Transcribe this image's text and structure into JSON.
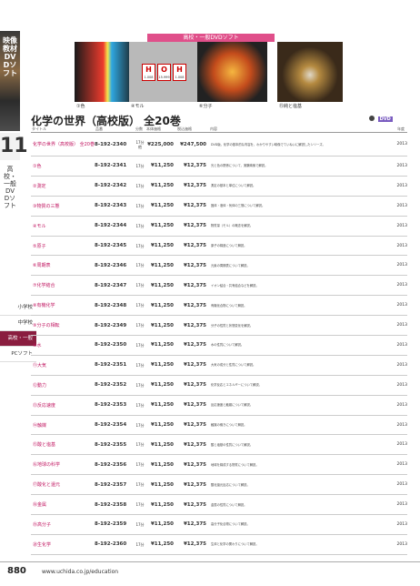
{
  "side": {
    "vertical_title": "映像教材 DVDソフト",
    "number": "11",
    "category": "高校・一般DVDソフト",
    "tabs": [
      "小学校",
      "中学校",
      "高校・一般",
      "PCソフト"
    ],
    "active_tab": 2
  },
  "header_bar": "高校・一般DVDソフト",
  "captions": [
    "①色",
    "④モル",
    "⑥分子",
    "⑮純と塩基"
  ],
  "elements": [
    {
      "symbol": "H",
      "number": "1",
      "mass": "1.008"
    },
    {
      "symbol": "O",
      "number": "8",
      "mass": "15.999"
    },
    {
      "symbol": "H",
      "number": "1",
      "mass": "1.008"
    }
  ],
  "series_title": "化学の世界（高校版） 全20巻",
  "dvd_label": "DVD",
  "columns": [
    "タイトル",
    "品番",
    "分数",
    "本体価格",
    "税込価格",
    "内容",
    "年度"
  ],
  "rows": [
    {
      "title": "化学の世界（高校版） 全20巻",
      "code": "8-192-2340",
      "min": "17分 他",
      "price": "¥225,000",
      "tax": "¥247,500",
      "desc": "DVD版。化学の基本的な内容を、わかりやすい映像でていねいに解説したシリーズ。",
      "year": "2013"
    },
    {
      "title": "①色",
      "code": "8-192-2341",
      "min": "17分",
      "price": "¥11,250",
      "tax": "¥12,375",
      "desc": "光と色の関係について、実験映像で解説。",
      "year": "2013"
    },
    {
      "title": "②測定",
      "code": "8-192-2342",
      "min": "17分",
      "price": "¥11,250",
      "tax": "¥12,375",
      "desc": "測定の基本と単位について解説。",
      "year": "2013"
    },
    {
      "title": "③物質の三態",
      "code": "8-192-2343",
      "min": "17分",
      "price": "¥11,250",
      "tax": "¥12,375",
      "desc": "固体・液体・気体の三態について解説。",
      "year": "2013"
    },
    {
      "title": "④モル",
      "code": "8-192-2344",
      "min": "17分",
      "price": "¥11,250",
      "tax": "¥12,375",
      "desc": "物質量（モル）の概念を解説。",
      "year": "2013"
    },
    {
      "title": "⑤原子",
      "code": "8-192-2345",
      "min": "17分",
      "price": "¥11,250",
      "tax": "¥12,375",
      "desc": "原子の構造について解説。",
      "year": "2013"
    },
    {
      "title": "⑥周期表",
      "code": "8-192-2346",
      "min": "17分",
      "price": "¥11,250",
      "tax": "¥12,375",
      "desc": "元素の周期表について解説。",
      "year": "2013"
    },
    {
      "title": "⑦化学結合",
      "code": "8-192-2347",
      "min": "17分",
      "price": "¥11,250",
      "tax": "¥12,375",
      "desc": "イオン結合・共有結合などを解説。",
      "year": "2013"
    },
    {
      "title": "⑧有機化学",
      "code": "8-192-2348",
      "min": "17分",
      "price": "¥11,250",
      "tax": "¥12,375",
      "desc": "有機化合物について解説。",
      "year": "2013"
    },
    {
      "title": "⑨分子の相転",
      "code": "8-192-2349",
      "min": "17分",
      "price": "¥11,250",
      "tax": "¥12,375",
      "desc": "分子の性質と状態変化を解説。",
      "year": "2013"
    },
    {
      "title": "⑩水",
      "code": "8-192-2350",
      "min": "17分",
      "price": "¥11,250",
      "tax": "¥12,375",
      "desc": "水の性質について解説。",
      "year": "2013"
    },
    {
      "title": "⑪大気",
      "code": "8-192-2351",
      "min": "17分",
      "price": "¥11,250",
      "tax": "¥12,375",
      "desc": "大気の成分と性質について解説。",
      "year": "2013"
    },
    {
      "title": "⑫動力",
      "code": "8-192-2352",
      "min": "17分",
      "price": "¥11,250",
      "tax": "¥12,375",
      "desc": "化学反応とエネルギーについて解説。",
      "year": "2013"
    },
    {
      "title": "⑬反応速度",
      "code": "8-192-2353",
      "min": "17分",
      "price": "¥11,250",
      "tax": "¥12,375",
      "desc": "反応速度と触媒について解説。",
      "year": "2013"
    },
    {
      "title": "⑭触媒",
      "code": "8-192-2354",
      "min": "17分",
      "price": "¥11,250",
      "tax": "¥12,375",
      "desc": "触媒の働きについて解説。",
      "year": "2013"
    },
    {
      "title": "⑮酸と塩基",
      "code": "8-192-2355",
      "min": "17分",
      "price": "¥11,250",
      "tax": "¥12,375",
      "desc": "酸と塩基の性質について解説。",
      "year": "2013"
    },
    {
      "title": "⑯地球の科学",
      "code": "8-192-2356",
      "min": "17分",
      "price": "¥11,250",
      "tax": "¥12,375",
      "desc": "地球を構成する物質について解説。",
      "year": "2013"
    },
    {
      "title": "⑰酸化と還元",
      "code": "8-192-2357",
      "min": "17分",
      "price": "¥11,250",
      "tax": "¥12,375",
      "desc": "酸化還元反応について解説。",
      "year": "2013"
    },
    {
      "title": "⑱金属",
      "code": "8-192-2358",
      "min": "17分",
      "price": "¥11,250",
      "tax": "¥12,375",
      "desc": "金属の性質について解説。",
      "year": "2013"
    },
    {
      "title": "⑲高分子",
      "code": "8-192-2359",
      "min": "17分",
      "price": "¥11,250",
      "tax": "¥12,375",
      "desc": "高分子化合物について解説。",
      "year": "2013"
    },
    {
      "title": "⑳生化学",
      "code": "8-192-2360",
      "min": "17分",
      "price": "¥11,250",
      "tax": "¥12,375",
      "desc": "生体と化学の関わりについて解説。",
      "year": "2013"
    }
  ],
  "footer": {
    "page": "880",
    "url": "www.uchida.co.jp/education"
  }
}
